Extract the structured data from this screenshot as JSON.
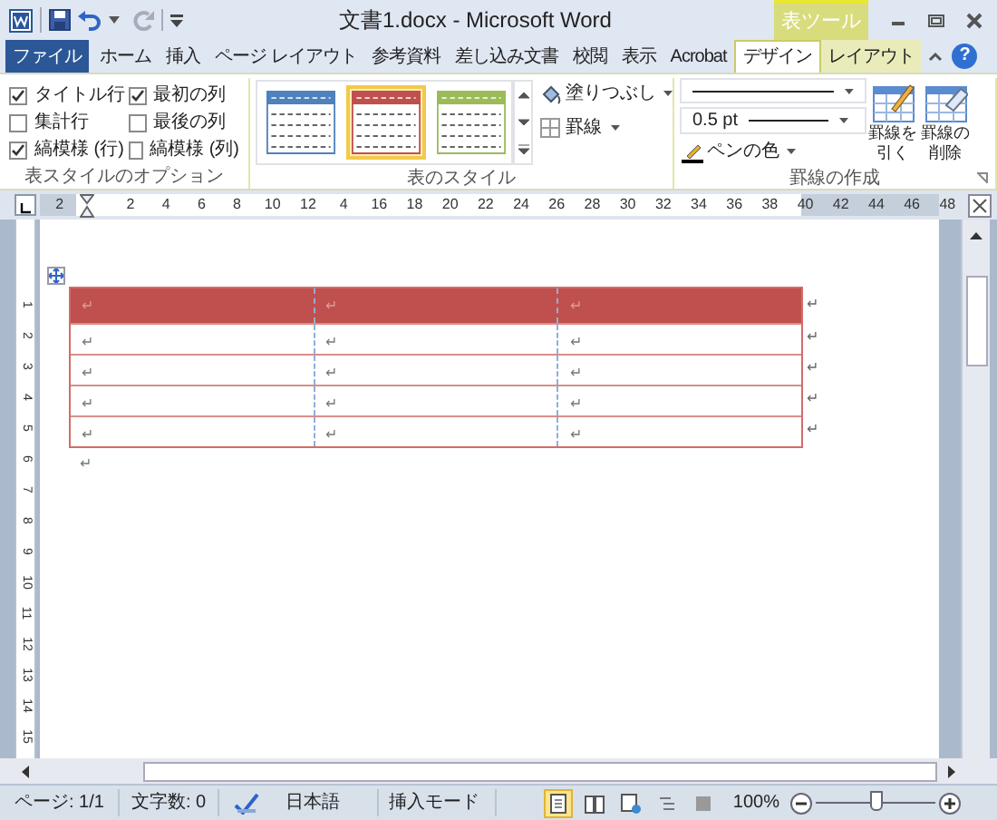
{
  "window": {
    "title": "文書1.docx - Microsoft Word",
    "context_tab": "表ツール"
  },
  "ribbon_tabs": [
    {
      "label": "ファイル",
      "kind": "file",
      "selected": false
    },
    {
      "label": "ホーム",
      "kind": "normal",
      "selected": false
    },
    {
      "label": "挿入",
      "kind": "normal",
      "selected": false
    },
    {
      "label": "ページ レイアウト",
      "kind": "normal",
      "selected": false
    },
    {
      "label": "参考資料",
      "kind": "normal",
      "selected": false
    },
    {
      "label": "差し込み文書",
      "kind": "normal",
      "selected": false
    },
    {
      "label": "校閲",
      "kind": "normal",
      "selected": false
    },
    {
      "label": "表示",
      "kind": "normal",
      "selected": false
    },
    {
      "label": "Acrobat",
      "kind": "normal",
      "selected": false
    },
    {
      "label": "デザイン",
      "kind": "context",
      "selected": true
    },
    {
      "label": "レイアウト",
      "kind": "context",
      "selected": false
    }
  ],
  "help_button": "?",
  "style_options": {
    "title": "表スタイルのオプション",
    "items": [
      {
        "label": "タイトル行",
        "checked": true
      },
      {
        "label": "集計行",
        "checked": false
      },
      {
        "label": "縞模様 (行)",
        "checked": true
      },
      {
        "label": "最初の列",
        "checked": true
      },
      {
        "label": "最後の列",
        "checked": false
      },
      {
        "label": "縞模様 (列)",
        "checked": false
      }
    ]
  },
  "table_styles": {
    "title": "表のスタイル",
    "items": [
      {
        "color": "#4f81bd",
        "selected": false
      },
      {
        "color": "#c0504d",
        "selected": true
      },
      {
        "color": "#9bbb59",
        "selected": false
      }
    ],
    "shading": "塗りつぶし",
    "borders": "罫線"
  },
  "draw_borders": {
    "title": "罫線の作成",
    "line_weight": "0.5 pt",
    "pen_color": "ペンの色",
    "draw_button": "罫線を引く",
    "erase_button": "罫線の削除"
  },
  "ruler": {
    "left_labels": [
      "2"
    ],
    "labels": [
      "2",
      "4",
      "6",
      "8",
      "10",
      "12",
      "4",
      "16",
      "18",
      "20",
      "22",
      "24",
      "26",
      "28",
      "30",
      "32",
      "34",
      "36",
      "38",
      "40",
      "42",
      "44",
      "46",
      "48"
    ]
  },
  "vertical_ruler": {
    "labels": [
      "1",
      "2",
      "3",
      "4",
      "5",
      "6",
      "7",
      "8",
      "9",
      "10",
      "11",
      "12",
      "13",
      "14",
      "15"
    ]
  },
  "document": {
    "table": {
      "rows": [
        [
          "↵",
          "↵",
          "↵"
        ],
        [
          "↵",
          "↵",
          "↵"
        ],
        [
          "↵",
          "↵",
          "↵"
        ],
        [
          "↵",
          "↵",
          "↵"
        ],
        [
          "↵",
          "↵",
          "↵"
        ]
      ],
      "row_end_mark": "↵"
    },
    "paragraph_mark": "↵"
  },
  "status_bar": {
    "page": "ページ: 1/1",
    "words": "文字数: 0",
    "language": "日本語",
    "mode": "挿入モード",
    "zoom": "100%",
    "zoom_slider": {
      "level": 0.5
    },
    "views": [
      {
        "kind": "print",
        "selected": true
      },
      {
        "kind": "reading",
        "selected": false
      },
      {
        "kind": "web",
        "selected": false
      },
      {
        "kind": "outline",
        "selected": false
      },
      {
        "kind": "draft",
        "selected": false
      }
    ]
  }
}
